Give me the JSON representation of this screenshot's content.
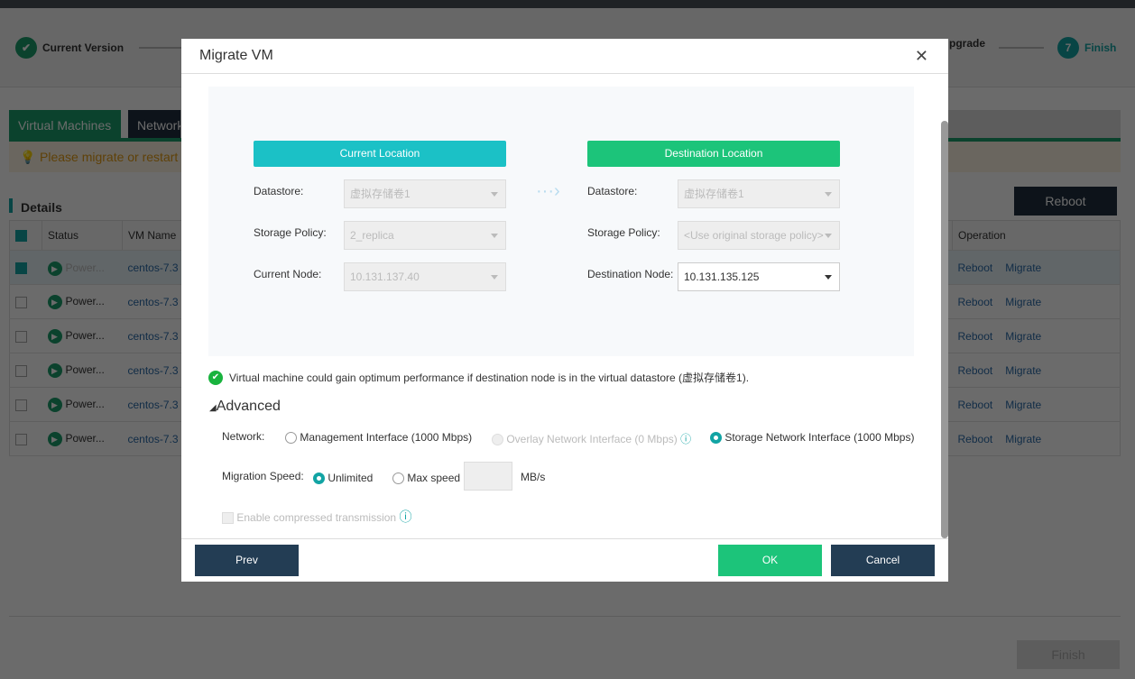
{
  "stepper": {
    "first": "Current Version",
    "partial": "pgrade",
    "last_num": "7",
    "last": "Finish"
  },
  "tabs": [
    "Virtual Machines",
    "Network"
  ],
  "warning": "Please migrate or restart",
  "details": {
    "title": "Details",
    "reboot": "Reboot"
  },
  "table": {
    "headers": [
      "Status",
      "VM Name",
      "Operation"
    ],
    "rows": [
      {
        "status": "Power...",
        "name": "centos-7.3",
        "checked": true
      },
      {
        "status": "Power...",
        "name": "centos-7.3",
        "checked": false
      },
      {
        "status": "Power...",
        "name": "centos-7.3",
        "checked": false
      },
      {
        "status": "Power...",
        "name": "centos-7.3",
        "checked": false
      },
      {
        "status": "Power...",
        "name": "centos-7.3",
        "checked": false
      },
      {
        "status": "Power...",
        "name": "centos-7.3",
        "checked": false
      }
    ],
    "ops": [
      "Reboot",
      "Migrate"
    ]
  },
  "finish": "Finish",
  "modal": {
    "title": "Migrate VM",
    "current": {
      "header": "Current Location",
      "datastore_label": "Datastore:",
      "datastore": "虚拟存储卷1",
      "policy_label": "Storage Policy:",
      "policy": "2_replica",
      "node_label": "Current Node:",
      "node": "10.131.137.40"
    },
    "dest": {
      "header": "Destination Location",
      "datastore_label": "Datastore:",
      "datastore": "虚拟存储卷1",
      "policy_label": "Storage Policy:",
      "policy": "<Use original storage policy>",
      "node_label": "Destination Node:",
      "node": "10.131.135.125"
    },
    "notice": "Virtual machine could gain optimum performance if destination node is in the virtual datastore (虚拟存储卷1).",
    "advanced": "Advanced",
    "network_label": "Network:",
    "network_options": [
      "Management Interface (1000 Mbps)",
      "Overlay Network Interface (0 Mbps)",
      "Storage Network Interface (1000 Mbps)"
    ],
    "speed_label": "Migration Speed:",
    "speed_options": [
      "Unlimited",
      "Max speed"
    ],
    "speed_unit": "MB/s",
    "compress": "Enable compressed transmission",
    "prev": "Prev",
    "ok": "OK",
    "cancel": "Cancel"
  }
}
